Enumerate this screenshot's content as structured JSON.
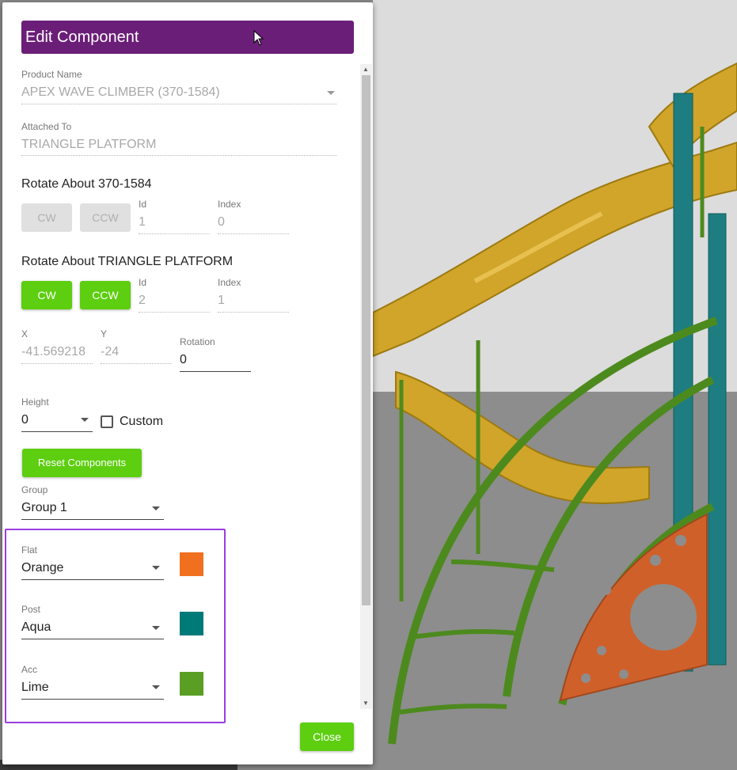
{
  "dialog": {
    "title": "Edit Component",
    "product_name": {
      "label": "Product Name",
      "value": "APEX WAVE CLIMBER (370-1584)"
    },
    "attached_to": {
      "label": "Attached To",
      "value": "TRIANGLE PLATFORM"
    },
    "rotate_self": {
      "heading": "Rotate About 370-1584",
      "cw_label": "CW",
      "ccw_label": "CCW",
      "id_label": "Id",
      "id_value": "1",
      "index_label": "Index",
      "index_value": "0"
    },
    "rotate_parent": {
      "heading": "Rotate About TRIANGLE PLATFORM",
      "cw_label": "CW",
      "ccw_label": "CCW",
      "id_label": "Id",
      "id_value": "2",
      "index_label": "Index",
      "index_value": "1"
    },
    "position": {
      "x_label": "X",
      "x_value": "-41.569218",
      "y_label": "Y",
      "y_value": "-24",
      "rotation_label": "Rotation",
      "rotation_value": "0"
    },
    "height": {
      "label": "Height",
      "value": "0",
      "custom_label": "Custom"
    },
    "reset_label": "Reset Components",
    "group": {
      "label": "Group",
      "value": "Group 1"
    },
    "colors": {
      "flat": {
        "label": "Flat",
        "value": "Orange",
        "color": "#f07020"
      },
      "post": {
        "label": "Post",
        "value": "Aqua",
        "color": "#007a78"
      },
      "acc": {
        "label": "Acc",
        "value": "Lime",
        "color": "#5a9f24"
      }
    },
    "close_label": "Close"
  }
}
